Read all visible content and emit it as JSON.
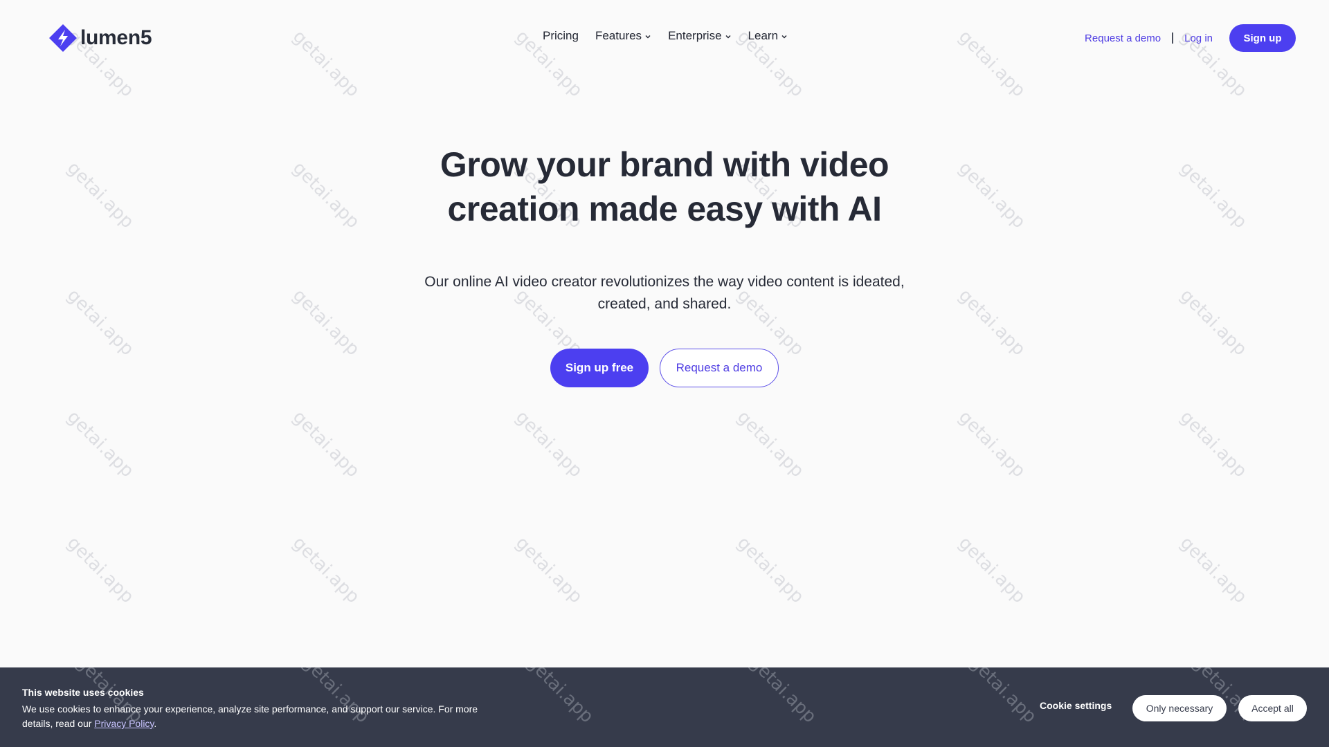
{
  "brand": {
    "name": "lumen5",
    "accent_color": "#4c3ff0",
    "logo_icon": "lumen5-logo-icon"
  },
  "nav": {
    "items": [
      {
        "label": "Pricing",
        "has_dropdown": false
      },
      {
        "label": "Features",
        "has_dropdown": true
      },
      {
        "label": "Enterprise",
        "has_dropdown": true
      },
      {
        "label": "Learn",
        "has_dropdown": true
      }
    ]
  },
  "header_actions": {
    "request_demo": "Request a demo",
    "separator": "|",
    "login": "Log in",
    "signup": "Sign up"
  },
  "hero": {
    "title_line1": "Grow your brand with video",
    "title_line2": "creation made easy with AI",
    "subtitle_line1": "Our online AI video creator revolutionizes the way video content is ideated,",
    "subtitle_line2": "created, and shared.",
    "primary_cta": "Sign up free",
    "secondary_cta": "Request a demo"
  },
  "watermark": "getai.app",
  "cookie_banner": {
    "title": "This website uses cookies",
    "text": "We use cookies to enhance your experience, analyze site performance, and support our service. For more details, read our ",
    "link": "Privacy Policy",
    "text_end": ".",
    "settings": "Cookie settings",
    "only_necessary": "Only necessary",
    "accept_all": "Accept all",
    "background_color": "#363b4b"
  }
}
